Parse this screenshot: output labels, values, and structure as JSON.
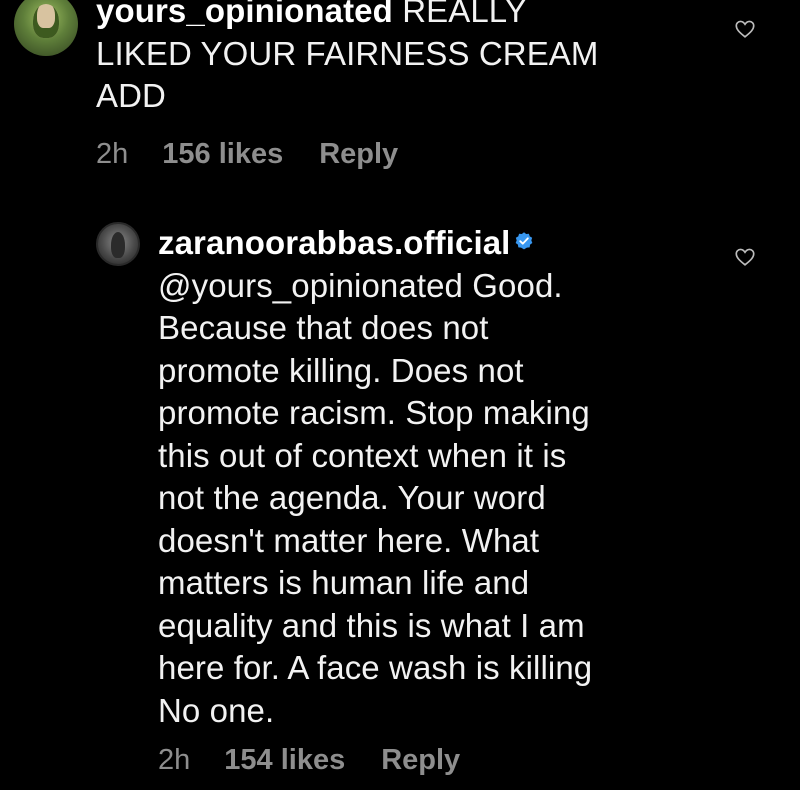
{
  "comments": [
    {
      "username": "yours_opinionated",
      "text": "REALLY\nLIKED YOUR FAIRNESS CREAM\nADD",
      "time": "2h",
      "likes": "156 likes",
      "reply_label": "Reply",
      "icons": {
        "avatar": "user-avatar",
        "like": "heart-icon"
      }
    },
    {
      "username": "zaranoorabbas.official",
      "verified": true,
      "text": "@yours_opinionated Good.\nBecause that does not\npromote killing. Does not\npromote racism. Stop making\nthis out of context when it is\nnot the agenda. Your word\ndoesn't matter here. What\nmatters is human life and\nequality and this is what I am\nhere for. A face wash is killing\nNo one.",
      "time": "2h",
      "likes": "154 likes",
      "reply_label": "Reply",
      "icons": {
        "avatar": "user-avatar",
        "verified": "verified-badge-icon",
        "like": "heart-icon"
      }
    }
  ],
  "colors": {
    "background": "#000000",
    "text": "#f2f2f2",
    "meta": "#8e8e8e",
    "verified": "#3897f0"
  }
}
